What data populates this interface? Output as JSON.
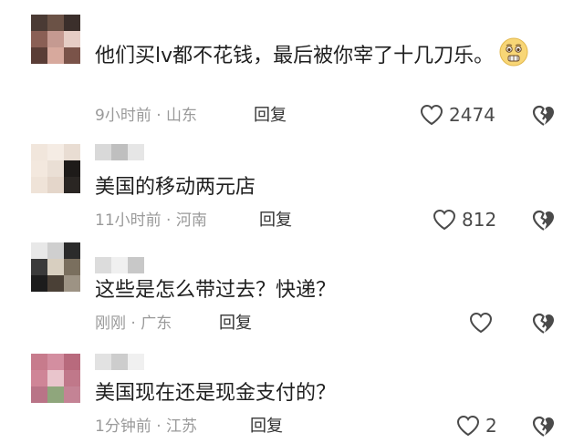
{
  "comments": [
    {
      "text": "他们买lv都不花钱，最后被你宰了十几刀乐。",
      "time": "9小时前",
      "location": "山东",
      "reply_label": "回复",
      "like_count": "2474",
      "emoji": "pleading-face-emoji"
    },
    {
      "text": "美国的移动两元店",
      "time": "11小时前",
      "location": "河南",
      "reply_label": "回复",
      "like_count": "812"
    },
    {
      "text": "这些是怎么带过去？快递？",
      "time": "刚刚",
      "location": "广东",
      "reply_label": "回复",
      "like_count": ""
    },
    {
      "text": "美国现在还是现金支付的？",
      "time": "1分钟前",
      "location": "江苏",
      "reply_label": "回复",
      "like_count": "2"
    }
  ],
  "meta_separator": " · ",
  "icons": {
    "like": "heart-outline-icon",
    "dislike": "broken-heart-icon"
  },
  "colors": {
    "text": "#1f1f1f",
    "meta": "#9a9a9a",
    "icon": "#4a4a4a"
  }
}
